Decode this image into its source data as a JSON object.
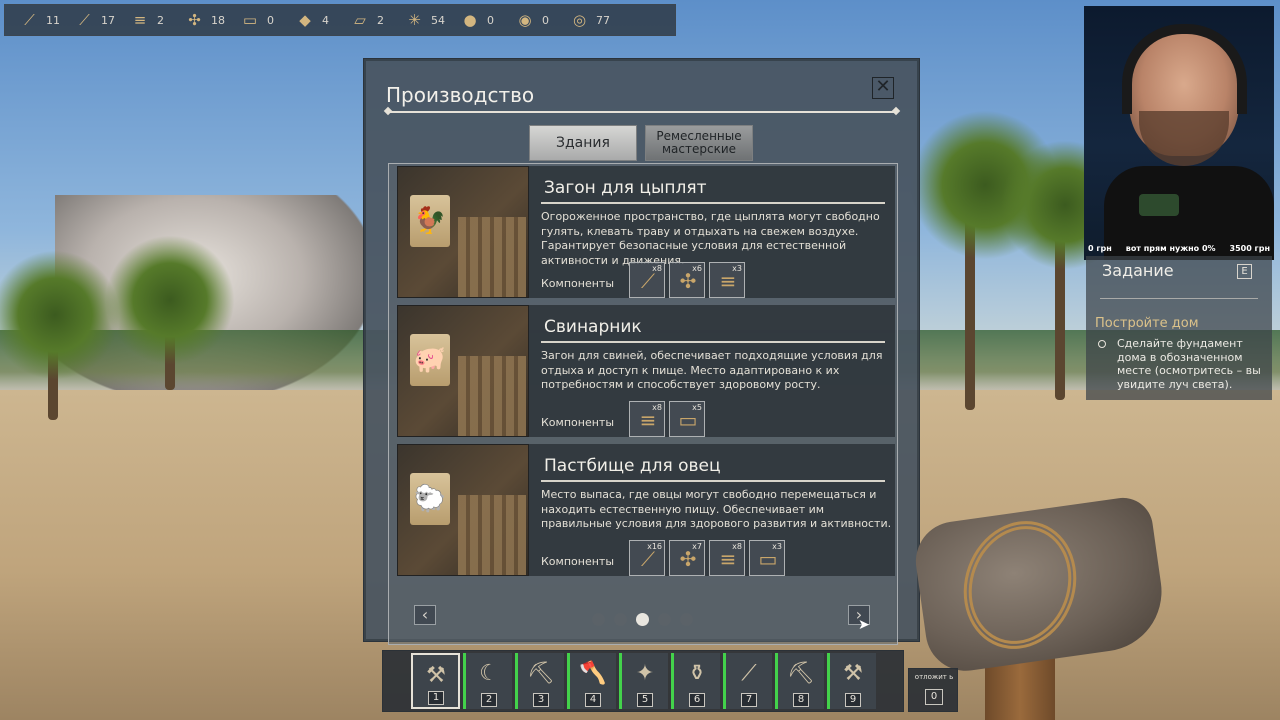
{
  "resources": [
    {
      "icon": "stick-icon",
      "glyph": "⟋",
      "count": "11"
    },
    {
      "icon": "branch-icon",
      "glyph": "⟋",
      "count": "17"
    },
    {
      "icon": "log-icon",
      "glyph": "≡",
      "count": "2"
    },
    {
      "icon": "fiber-icon",
      "glyph": "✣",
      "count": "18"
    },
    {
      "icon": "plank-icon",
      "glyph": "▭",
      "count": "0"
    },
    {
      "icon": "bark-icon",
      "glyph": "◆",
      "count": "4"
    },
    {
      "icon": "board-icon",
      "glyph": "▱",
      "count": "2"
    },
    {
      "icon": "leaf-icon",
      "glyph": "✳",
      "count": "54"
    },
    {
      "icon": "stone-icon",
      "glyph": "●",
      "count": "0"
    },
    {
      "icon": "coin-icon",
      "glyph": "◉",
      "count": "0"
    },
    {
      "icon": "gem-icon",
      "glyph": "◎",
      "count": "77"
    }
  ],
  "panel": {
    "title": "Производство",
    "close_label": "✕",
    "tabs": {
      "buildings": "Здания",
      "crafts": "Ремесленные мастерские"
    },
    "components_label": "Компоненты"
  },
  "cards": [
    {
      "title": "Загон для цыплят",
      "sign": "🐓",
      "desc": "Огороженное пространство, где цыплята могут свободно гулять, клевать траву и отдыхать на свежем воздухе. Гарантирует безопасные условия для естественной активности и движения.",
      "components": [
        {
          "icon": "branch-icon",
          "glyph": "⟋",
          "qty": "x8"
        },
        {
          "icon": "fiber-icon",
          "glyph": "✣",
          "qty": "x6"
        },
        {
          "icon": "log-icon",
          "glyph": "≡",
          "qty": "x3"
        }
      ]
    },
    {
      "title": "Свинарник",
      "sign": "🐖",
      "desc": "Загон для свиней, обеспечивает подходящие условия для отдыха и доступ к пище. Место адаптировано к их потребностям и способствует здоровому росту.",
      "components": [
        {
          "icon": "log-icon",
          "glyph": "≡",
          "qty": "x8"
        },
        {
          "icon": "plank-icon",
          "glyph": "▭",
          "qty": "x5"
        }
      ]
    },
    {
      "title": "Пастбище для овец",
      "sign": "🐑",
      "desc": "Место выпаса, где овцы могут свободно перемещаться и находить естественную пищу. Обеспечивает им правильные условия для здорового развития и активности.",
      "components": [
        {
          "icon": "branch-icon",
          "glyph": "⟋",
          "qty": "x16"
        },
        {
          "icon": "fiber-icon",
          "glyph": "✣",
          "qty": "x7"
        },
        {
          "icon": "log-icon",
          "glyph": "≡",
          "qty": "x8"
        },
        {
          "icon": "plank-icon",
          "glyph": "▭",
          "qty": "x3"
        }
      ]
    }
  ],
  "pager": {
    "prev": "‹",
    "next": "›",
    "page_count": 5,
    "current_page": 3
  },
  "hotbar": [
    {
      "num": "1",
      "icon": "stone-hammer-icon",
      "glyph": "⚒"
    },
    {
      "num": "2",
      "icon": "sickle-icon",
      "glyph": "☾"
    },
    {
      "num": "3",
      "icon": "pickaxe-icon",
      "glyph": "⛏"
    },
    {
      "num": "4",
      "icon": "axe-icon",
      "glyph": "🪓"
    },
    {
      "num": "5",
      "icon": "seed-bag-icon",
      "glyph": "✦"
    },
    {
      "num": "6",
      "icon": "jug-icon",
      "glyph": "⚱"
    },
    {
      "num": "7",
      "icon": "hoe-icon",
      "glyph": "⟋"
    },
    {
      "num": "8",
      "icon": "pick-icon",
      "glyph": "⛏"
    },
    {
      "num": "9",
      "icon": "hammer-icon",
      "glyph": "⚒"
    }
  ],
  "drop": {
    "label": "отложит ь",
    "count": "0"
  },
  "stream": {
    "left": "0 грн",
    "middle": "вот прям нужно 0%",
    "right": "3500 грн"
  },
  "quest": {
    "title": "Задание",
    "key": "E",
    "goal": "Постройте дом",
    "desc": "Сделайте фундамент дома в обозначенном месте (осмотритесь – вы увидите луч света)."
  }
}
